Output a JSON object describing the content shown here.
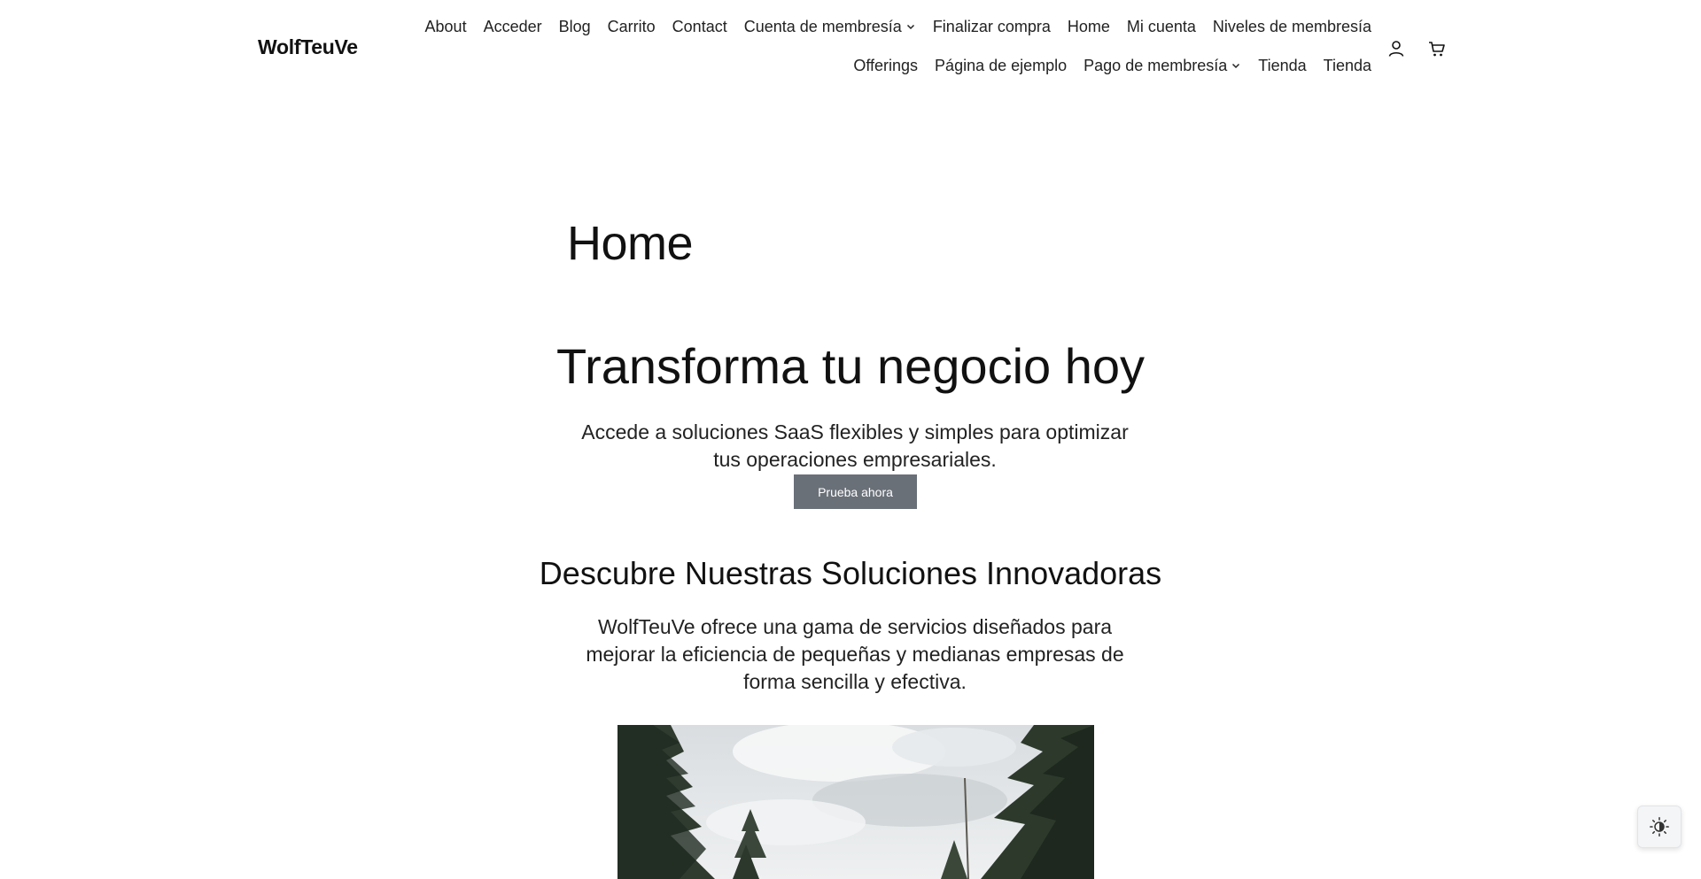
{
  "site": {
    "title": "WolfTeuVe"
  },
  "nav": {
    "row1": [
      {
        "label": "About"
      },
      {
        "label": "Acceder"
      },
      {
        "label": "Blog"
      },
      {
        "label": "Carrito"
      },
      {
        "label": "Contact"
      },
      {
        "label": "Cuenta de membresía",
        "has_submenu": true
      },
      {
        "label": "Finalizar compra"
      },
      {
        "label": "Home"
      },
      {
        "label": "Mi cuenta"
      },
      {
        "label": "Niveles de membresía"
      }
    ],
    "row2": [
      {
        "label": "Offerings"
      },
      {
        "label": "Página de ejemplo"
      },
      {
        "label": "Pago de membresía",
        "has_submenu": true
      },
      {
        "label": "Tienda"
      },
      {
        "label": "Tienda"
      }
    ]
  },
  "header_icons": {
    "account": "user-icon",
    "cart": "cart-icon"
  },
  "page": {
    "title": "Home"
  },
  "hero": {
    "title": "Transforma tu negocio hoy",
    "text": "Accede a soluciones SaaS flexibles y simples para optimizar tus operaciones empresariales.",
    "cta_label": "Prueba ahora"
  },
  "solutions": {
    "title": "Descubre Nuestras Soluciones Innovadoras",
    "text": "WolfTeuVe ofrece una gama de servicios diseñados para mejorar la eficiencia de pequeñas y medianas empresas de forma sencilla y efectiva."
  },
  "theme_toggle": {
    "icon": "contrast-sun-icon"
  },
  "colors": {
    "cta_bg": "#6a7078",
    "text": "#111111",
    "background": "#ffffff"
  }
}
